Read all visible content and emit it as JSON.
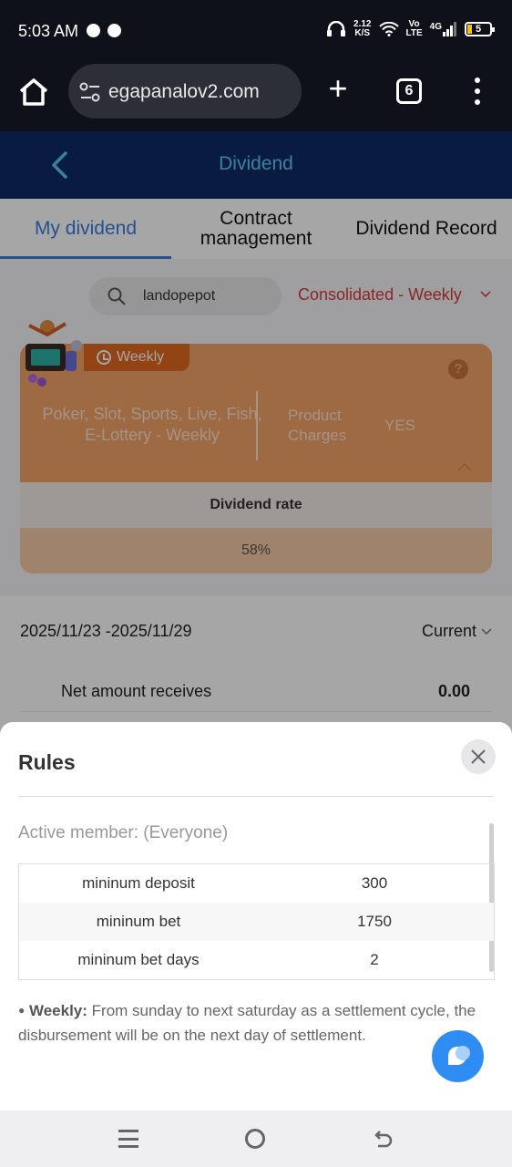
{
  "status_bar": {
    "time": "5:03 AM",
    "net_speed_value": "2.12",
    "net_speed_unit": "K/S",
    "volte": "Vo\nLTE",
    "network": "4G",
    "battery": "5"
  },
  "browser": {
    "url": "egapanalov2.com",
    "tab_count": "6"
  },
  "app": {
    "title": "Dividend",
    "tabs": [
      {
        "label": "My dividend"
      },
      {
        "label": "Contract\nmanagement"
      },
      {
        "label": "Dividend Record"
      }
    ]
  },
  "filters": {
    "search_value": "landopepot",
    "period": "Consolidated - Weekly"
  },
  "card": {
    "badge": "Weekly",
    "products": "Poker, Slot, Sports, Live, Fish, E-Lottery - Weekly",
    "product_charges_label": "Product\nCharges",
    "product_charges_value": "YES",
    "dividend_rate_label": "Dividend rate",
    "dividend_rate_value": "58%"
  },
  "period_row": {
    "dates": "2025/11/23 -2025/11/29",
    "current": "Current"
  },
  "net_row": {
    "label": "Net amount receives",
    "value": "0.00"
  },
  "rules": {
    "title": "Rules",
    "active_member": "Active member: (Everyone)",
    "rows": [
      {
        "name": "mininum deposit",
        "value": "300"
      },
      {
        "name": "mininum bet",
        "value": "1750"
      },
      {
        "name": "mininum bet days",
        "value": "2"
      }
    ],
    "note_label": "Weekly:",
    "note_text": " From sunday to next saturday as a settlement cycle, the disbursement will be on the next day of settlement."
  },
  "colors": {
    "header_bg": "#0e2a64",
    "accent_blue": "#3b7be0",
    "period_red": "#d83a3a",
    "card_orange": "#f3a468"
  }
}
